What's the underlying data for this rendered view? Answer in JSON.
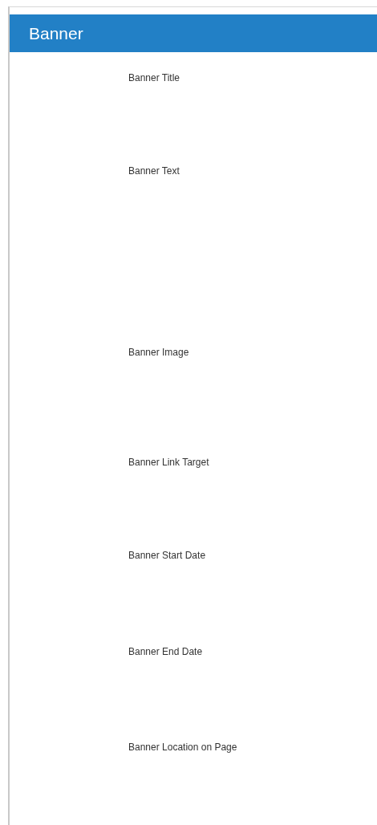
{
  "panel": {
    "title": "Banner"
  },
  "fields": [
    {
      "label": "Banner Title",
      "kind": "text"
    },
    {
      "label": "Banner Text",
      "kind": "textarea"
    },
    {
      "label": "Banner Image",
      "kind": "image"
    },
    {
      "label": "Banner Link Target",
      "kind": "link"
    },
    {
      "label": "Banner Start Date",
      "kind": "date"
    },
    {
      "label": "Banner End Date",
      "kind": "date"
    },
    {
      "label": "Banner Location on Page",
      "kind": "select"
    }
  ]
}
